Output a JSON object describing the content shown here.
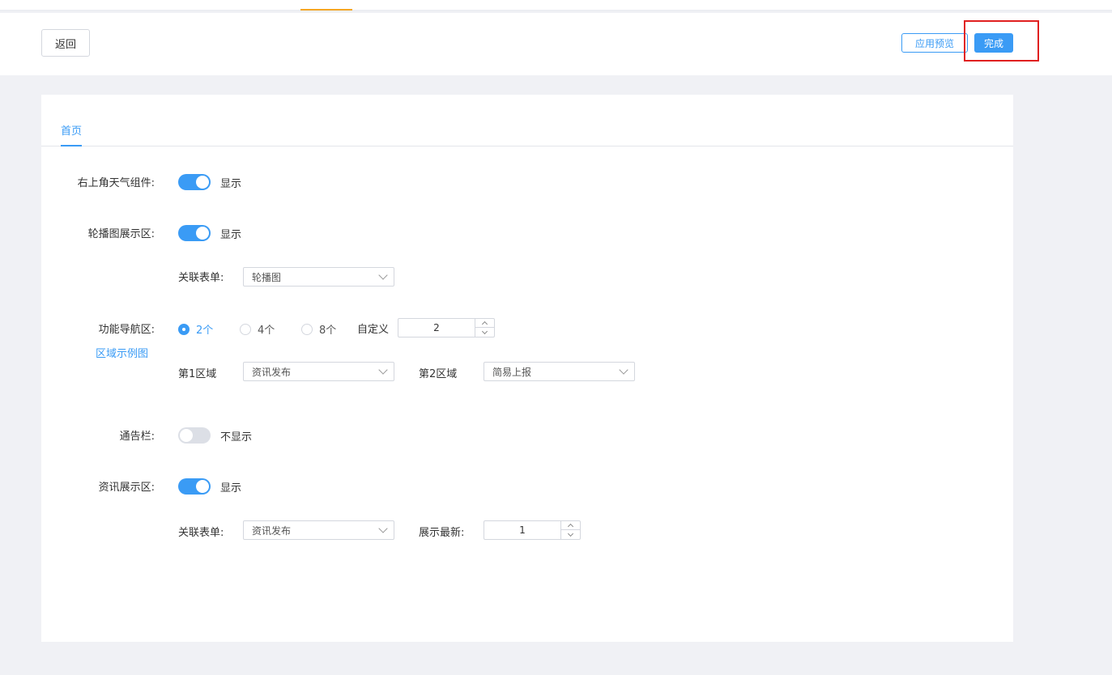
{
  "header": {
    "back_label": "返回",
    "preview_label": "应用预览",
    "done_label": "完成"
  },
  "tabs": [
    {
      "label": "首页"
    }
  ],
  "weather": {
    "label": "右上角天气组件:",
    "switch_on": true,
    "status": "显示"
  },
  "carousel": {
    "label": "轮播图展示区:",
    "switch_on": true,
    "status": "显示",
    "form_label": "关联表单:",
    "form_value": "轮播图"
  },
  "nav": {
    "label": "功能导航区:",
    "example_link": "区域示例图",
    "options": [
      {
        "label": "2个",
        "selected": true
      },
      {
        "label": "4个",
        "selected": false
      },
      {
        "label": "8个",
        "selected": false
      }
    ],
    "custom_label": "自定义",
    "custom_value": "2",
    "areas": [
      {
        "label": "第1区域",
        "value": "资讯发布"
      },
      {
        "label": "第2区域",
        "value": "简易上报"
      }
    ]
  },
  "notice": {
    "label": "通告栏:",
    "switch_on": false,
    "status": "不显示"
  },
  "news": {
    "label": "资讯展示区:",
    "switch_on": true,
    "status": "显示",
    "form_label": "关联表单:",
    "form_value": "资讯发布",
    "latest_label": "展示最新:",
    "latest_value": "1"
  },
  "colors": {
    "accent": "#3a9bf5",
    "tab_indicator": "#f5a623",
    "highlight": "#e02020"
  }
}
